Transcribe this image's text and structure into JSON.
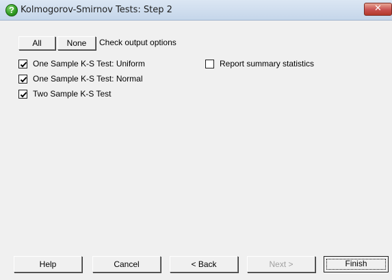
{
  "window": {
    "title": "Kolmogorov-Smirnov Tests: Step 2",
    "close_glyph": "✕"
  },
  "options": {
    "all_label": "All",
    "none_label": "None",
    "heading": "Check output options",
    "items": [
      {
        "label": "One Sample K-S Test: Uniform",
        "checked": true
      },
      {
        "label": "One Sample K-S Test: Normal",
        "checked": true
      },
      {
        "label": "Two Sample K-S Test",
        "checked": true
      },
      {
        "label": "Report summary statistics",
        "checked": false
      }
    ]
  },
  "buttons": {
    "help": "Help",
    "cancel": "Cancel",
    "back": "< Back",
    "next": "Next >",
    "finish": "Finish"
  }
}
